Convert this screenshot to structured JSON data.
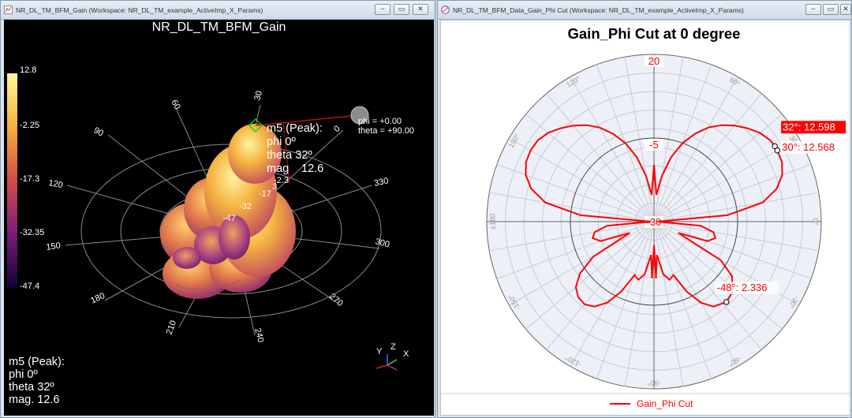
{
  "left_window": {
    "title": "NR_DL_TM_BFM_Gain (Workspace: NR_DL_TM_example_ActiveImp_X_Params)",
    "plot_title": "NR_DL_TM_BFM_Gain",
    "colorbar_labels": [
      "12.8",
      "-2.25",
      "-17.3",
      "-32.35",
      "-47.4"
    ],
    "phi_ring_labels": [
      "30",
      "60",
      "90",
      "120",
      "150",
      "180",
      "210",
      "240",
      "270",
      "300",
      "330",
      "0"
    ],
    "radial_labels": [
      "3",
      "-2.3",
      "-17",
      "-32",
      "-47"
    ],
    "marker_bubble": [
      "m5 (Peak):",
      "phi 0º",
      "theta 32º",
      "mag",
      "12.6"
    ],
    "probe_readout": [
      "phi  = +0.00",
      "theta = +90.00"
    ],
    "marker_bottom": [
      "m5 (Peak):",
      "phi 0º",
      "theta 32º",
      "mag.  12.6"
    ],
    "axes": [
      "Y",
      "Z",
      "X"
    ],
    "buttons": {
      "minimize": "−",
      "restore": "▭",
      "close": "✕"
    }
  },
  "right_window": {
    "title": "NR_DL_TM_BFM_Data_Gain_Phi Cut (Workspace: NR_DL_TM_example_ActiveImp_X_Params)",
    "buttons": {
      "minimize": "−",
      "restore": "▭",
      "close": "✕"
    },
    "legend_label": "Gain_Phi Cut"
  },
  "chart_data": {
    "type": "polar",
    "title": "Gain_Phi Cut at 0 degree",
    "series": [
      {
        "name": "Gain_Phi Cut",
        "color": "#ff0000"
      }
    ],
    "radial_range": [
      -30,
      20
    ],
    "radial_tick_labels": [
      "20",
      "-5",
      "-30"
    ],
    "angle_tick_labels": [
      "0°",
      "30°",
      "60°",
      "90°",
      "120°",
      "150°",
      "±180",
      "-150°",
      "-120°",
      "-90°",
      "-60°",
      "-30°"
    ],
    "points": [
      {
        "angle": 0,
        "value": -29
      },
      {
        "angle": 5,
        "value": -8
      },
      {
        "angle": 10,
        "value": 3
      },
      {
        "angle": 15,
        "value": 8
      },
      {
        "angle": 20,
        "value": 10.8
      },
      {
        "angle": 25,
        "value": 12.2
      },
      {
        "angle": 30,
        "value": 12.568
      },
      {
        "angle": 32,
        "value": 12.598
      },
      {
        "angle": 35,
        "value": 12.4
      },
      {
        "angle": 40,
        "value": 11.3
      },
      {
        "angle": 45,
        "value": 9.5
      },
      {
        "angle": 50,
        "value": 7.5
      },
      {
        "angle": 55,
        "value": 5.2
      },
      {
        "angle": 60,
        "value": 2.5
      },
      {
        "angle": 65,
        "value": -1
      },
      {
        "angle": 70,
        "value": -5
      },
      {
        "angle": 75,
        "value": -10
      },
      {
        "angle": 80,
        "value": -16
      },
      {
        "angle": 85,
        "value": -22
      },
      {
        "angle": 90,
        "value": -13
      },
      {
        "angle": 95,
        "value": -22
      },
      {
        "angle": 100,
        "value": -16
      },
      {
        "angle": 105,
        "value": -10
      },
      {
        "angle": 110,
        "value": -5
      },
      {
        "angle": 115,
        "value": -1
      },
      {
        "angle": 120,
        "value": 2.5
      },
      {
        "angle": 125,
        "value": 5.2
      },
      {
        "angle": 130,
        "value": 7.5
      },
      {
        "angle": 135,
        "value": 9.5
      },
      {
        "angle": 140,
        "value": 11.3
      },
      {
        "angle": 145,
        "value": 12.4
      },
      {
        "angle": 150,
        "value": 12.598
      },
      {
        "angle": 155,
        "value": 12.2
      },
      {
        "angle": 160,
        "value": 10.8
      },
      {
        "angle": 165,
        "value": 8
      },
      {
        "angle": 170,
        "value": 3
      },
      {
        "angle": 175,
        "value": -8
      },
      {
        "angle": 180,
        "value": -29
      },
      {
        "angle": 185,
        "value": -16
      },
      {
        "angle": 190,
        "value": -12
      },
      {
        "angle": 195,
        "value": -11
      },
      {
        "angle": 200,
        "value": -13
      },
      {
        "angle": 205,
        "value": -22
      },
      {
        "angle": 210,
        "value": -9
      },
      {
        "angle": 215,
        "value": -3
      },
      {
        "angle": 220,
        "value": 0.5
      },
      {
        "angle": 225,
        "value": 2
      },
      {
        "angle": 230,
        "value": 2.3
      },
      {
        "angle": 235,
        "value": 1
      },
      {
        "angle": 240,
        "value": -2
      },
      {
        "angle": 245,
        "value": -7
      },
      {
        "angle": 250,
        "value": -13
      },
      {
        "angle": 255,
        "value": -12
      },
      {
        "angle": 260,
        "value": -14
      },
      {
        "angle": 265,
        "value": -20
      },
      {
        "angle": 268,
        "value": -13
      },
      {
        "angle": 270,
        "value": -23
      },
      {
        "angle": 272,
        "value": -13
      },
      {
        "angle": 275,
        "value": -20
      },
      {
        "angle": 280,
        "value": -14
      },
      {
        "angle": 285,
        "value": -12
      },
      {
        "angle": 290,
        "value": -13
      },
      {
        "angle": 295,
        "value": -7
      },
      {
        "angle": 300,
        "value": -2
      },
      {
        "angle": 305,
        "value": 1
      },
      {
        "angle": 312,
        "value": 2.336
      },
      {
        "angle": 318,
        "value": 1.5
      },
      {
        "angle": 325,
        "value": -1.5
      },
      {
        "angle": 330,
        "value": -7
      },
      {
        "angle": 335,
        "value": -22
      },
      {
        "angle": 340,
        "value": -13
      },
      {
        "angle": 345,
        "value": -11
      },
      {
        "angle": 350,
        "value": -12
      },
      {
        "angle": 355,
        "value": -16
      },
      {
        "angle": 360,
        "value": -29
      }
    ],
    "markers": [
      {
        "angle": 32,
        "value": 12.598,
        "label": "32°: 12.598",
        "highlight": true
      },
      {
        "angle": 30,
        "value": 12.568,
        "label": "30°: 12.568",
        "highlight": false
      },
      {
        "angle": -48,
        "value": 2.336,
        "label": "-48°: 2.336",
        "highlight": false
      }
    ],
    "grid": true,
    "legend_position": "bottom"
  }
}
